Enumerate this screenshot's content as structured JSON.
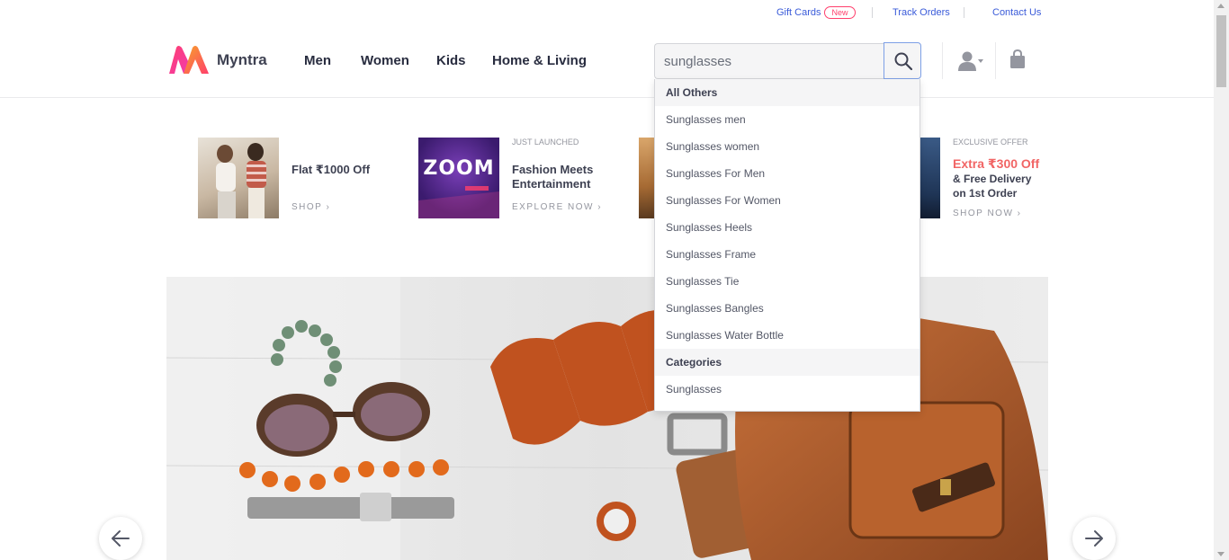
{
  "utility_links": {
    "gift_cards": "Gift Cards",
    "new_badge": "New",
    "track_orders": "Track Orders",
    "contact_us": "Contact Us"
  },
  "header": {
    "brand": "Myntra",
    "nav": [
      "Men",
      "Women",
      "Kids",
      "Home & Living"
    ],
    "search_value": "sunglasses"
  },
  "promos": [
    {
      "kicker": "",
      "title": "Flat ₹1000 Off",
      "cta": "SHOP"
    },
    {
      "kicker": "JUST LAUNCHED",
      "title_line1": "Fashion Meets",
      "title_line2": "Entertainment",
      "cta": "EXPLORE NOW",
      "thumb_text": "ZOOM"
    },
    {
      "kicker": "EXCLUSIVE OFFER",
      "title_line1": "Extra ₹300 Off",
      "title_line2": "& Free Delivery",
      "title_line3": "on 1st Order",
      "cta": "SHOP NOW"
    }
  ],
  "suggestions": {
    "group_all": "All Others",
    "items": [
      "Sunglasses men",
      "Sunglasses women",
      "Sunglasses For Men",
      "Sunglasses For Women",
      "Sunglasses Heels",
      "Sunglasses Frame",
      "Sunglasses Tie",
      "Sunglasses Bangles",
      "Sunglasses Water Bottle"
    ],
    "group_categories": "Categories",
    "category_items": [
      "Sunglasses"
    ]
  },
  "colors": {
    "accent_pink": "#ff3f6c",
    "link_blue": "#3a5bd9",
    "offer_orange": "#f16565"
  }
}
